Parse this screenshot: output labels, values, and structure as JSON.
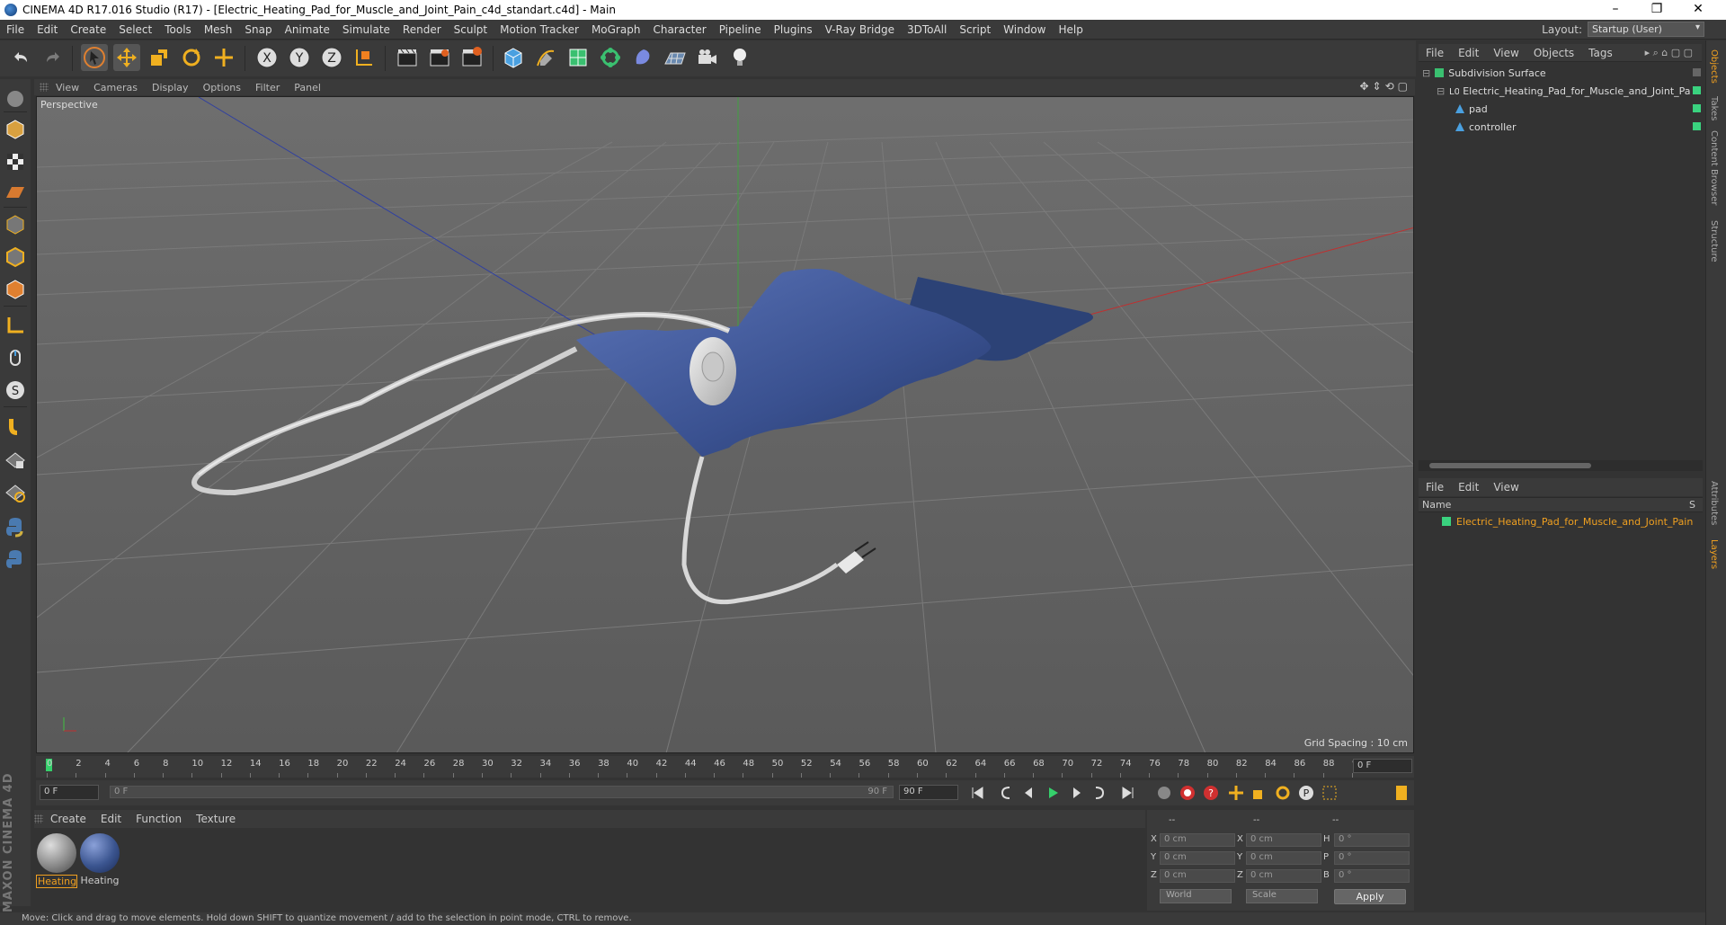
{
  "window": {
    "title": "CINEMA 4D R17.016 Studio (R17) - [Electric_Heating_Pad_for_Muscle_and_Joint_Pain_c4d_standart.c4d] - Main",
    "minimize": "–",
    "restore": "❐",
    "close": "✕"
  },
  "menubar": {
    "items": [
      "File",
      "Edit",
      "Create",
      "Select",
      "Tools",
      "Mesh",
      "Snap",
      "Animate",
      "Simulate",
      "Render",
      "Sculpt",
      "Motion Tracker",
      "MoGraph",
      "Character",
      "Pipeline",
      "Plugins",
      "V-Ray Bridge",
      "3DToAll",
      "Script",
      "Window",
      "Help"
    ],
    "layout_label": "Layout:",
    "layout_value": "Startup (User)"
  },
  "toolbar": {
    "icons": [
      "undo-icon",
      "redo-icon",
      "select-arrow-icon",
      "move-icon",
      "scale-icon",
      "rotate-icon",
      "add-object-icon",
      "x-axis-icon",
      "y-axis-icon",
      "z-axis-icon",
      "world-coord-icon",
      "render-view-icon",
      "render-picture-queue-icon",
      "render-settings-icon",
      "cube-primitive-icon",
      "pen-spline-icon",
      "subdivision-icon",
      "array-icon",
      "deformer-icon",
      "floor-icon",
      "camera-icon",
      "light-icon"
    ]
  },
  "viewport": {
    "menu": [
      "View",
      "Cameras",
      "Display",
      "Options",
      "Filter",
      "Panel"
    ],
    "label": "Perspective",
    "grid_spacing": "Grid Spacing : 10 cm"
  },
  "timeline": {
    "ticks": [
      "0",
      "2",
      "4",
      "6",
      "8",
      "10",
      "12",
      "14",
      "16",
      "18",
      "20",
      "22",
      "24",
      "26",
      "28",
      "30",
      "32",
      "34",
      "36",
      "38",
      "40",
      "42",
      "44",
      "46",
      "48",
      "50",
      "52",
      "54",
      "56",
      "58",
      "60",
      "62",
      "64",
      "66",
      "68",
      "70",
      "72",
      "74",
      "76",
      "78",
      "80",
      "82",
      "84",
      "86",
      "88",
      "90"
    ],
    "current_frame": "0 F"
  },
  "transport": {
    "start_field": "0 F",
    "slider_start": "0 F",
    "slider_end": "90 F",
    "end_field": "90 F"
  },
  "materials": {
    "menu": [
      "Create",
      "Edit",
      "Function",
      "Texture"
    ],
    "items": [
      {
        "name": "Heating",
        "color": "#8a8a8a"
      },
      {
        "name": "Heating",
        "color": "#3b5590"
      }
    ]
  },
  "coordinates": {
    "header": [
      "--",
      "--",
      "--"
    ],
    "rows": [
      {
        "axis1": "X",
        "pos": "0 cm",
        "axis2": "X",
        "size": "0 cm",
        "axis3": "H",
        "rot": "0 °"
      },
      {
        "axis1": "Y",
        "pos": "0 cm",
        "axis2": "Y",
        "size": "0 cm",
        "axis3": "P",
        "rot": "0 °"
      },
      {
        "axis1": "Z",
        "pos": "0 cm",
        "axis2": "Z",
        "size": "0 cm",
        "axis3": "B",
        "rot": "0 °"
      }
    ],
    "mode": "World",
    "scale": "Scale",
    "apply": "Apply"
  },
  "maxon": "MAXON CINEMA 4D",
  "status": "Move: Click and drag to move elements. Hold down SHIFT to quantize movement / add to the selection in point mode, CTRL to remove.",
  "objects": {
    "menu": [
      "File",
      "Edit",
      "View",
      "Objects",
      "Tags"
    ],
    "tree": [
      {
        "name": "Subdivision Surface",
        "level": 0
      },
      {
        "name": "Electric_Heating_Pad_for_Muscle_and_Joint_Pain",
        "level": 1
      },
      {
        "name": "pad",
        "level": 2
      },
      {
        "name": "controller",
        "level": 2
      }
    ]
  },
  "layers": {
    "menu": [
      "File",
      "Edit",
      "View"
    ],
    "header_name": "Name",
    "header_s": "S",
    "row": "Electric_Heating_Pad_for_Muscle_and_Joint_Pain"
  },
  "right_tabs": [
    "Objects",
    "Takes",
    "Content Browser",
    "Structure",
    "Attributes",
    "Layers"
  ],
  "colors": {
    "accent_green": "#35d06b",
    "layer_orange": "#f0a020",
    "pad_blue": "#3b5590"
  }
}
